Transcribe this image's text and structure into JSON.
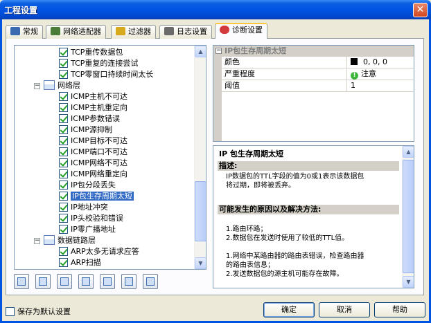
{
  "window": {
    "title": "工程设置",
    "close_glyph": "✕"
  },
  "tabs": [
    {
      "label": "常规",
      "icon": "grid-icon",
      "color": "#3a6ab0"
    },
    {
      "label": "网络适配器",
      "icon": "network-adapter-icon",
      "color": "#4a7c3a"
    },
    {
      "label": "过滤器",
      "icon": "filter-icon",
      "color": "#d7a91c"
    },
    {
      "label": "日志设置",
      "icon": "log-icon",
      "color": "#6b6b6b"
    },
    {
      "label": "诊断设置",
      "icon": "diagnosis-icon",
      "color": "#d33a3a",
      "active": true
    }
  ],
  "tree": {
    "items": [
      {
        "label": "TCP重传数据包",
        "type": "leaf"
      },
      {
        "label": "TCP重复的连接尝试",
        "type": "leaf"
      },
      {
        "label": "TCP零窗口持续时间太长",
        "type": "leaf"
      },
      {
        "label": "网络层",
        "type": "group",
        "expander": "−"
      },
      {
        "label": "ICMP主机不可达",
        "type": "leaf"
      },
      {
        "label": "ICMP主机重定向",
        "type": "leaf"
      },
      {
        "label": "ICMP参数错误",
        "type": "leaf"
      },
      {
        "label": "ICMP源抑制",
        "type": "leaf"
      },
      {
        "label": "ICMP目标不可达",
        "type": "leaf"
      },
      {
        "label": "ICMP端口不可达",
        "type": "leaf"
      },
      {
        "label": "ICMP网络不可达",
        "type": "leaf"
      },
      {
        "label": "ICMP网络重定向",
        "type": "leaf"
      },
      {
        "label": "IP包分段丢失",
        "type": "leaf"
      },
      {
        "label": "IP包生存周期太短",
        "type": "leaf",
        "selected": true
      },
      {
        "label": "IP地址冲突",
        "type": "leaf"
      },
      {
        "label": "IP头校验和错误",
        "type": "leaf"
      },
      {
        "label": "IP零广播地址",
        "type": "leaf"
      },
      {
        "label": "数据链路层",
        "type": "group",
        "expander": "−"
      },
      {
        "label": "ARP太多无请求应答",
        "type": "leaf"
      },
      {
        "label": "ARP扫描",
        "type": "leaf"
      }
    ],
    "scroll": {
      "thumb_fraction_start": 0.62,
      "thumb_fraction_size": 0.3,
      "up": "▲",
      "down": "▼"
    }
  },
  "toolbar": {
    "buttons": [
      "check-all-icon",
      "uncheck-all-icon",
      "invert-check-icon",
      "import-icon",
      "export-icon",
      "expand-icon",
      "collapse-icon"
    ]
  },
  "props": {
    "header": "IP包生存周期太短",
    "collapse_glyph": "−",
    "rows": [
      {
        "key": "颜色",
        "value": "0, 0, 0",
        "swatch": "#000000"
      },
      {
        "key": "严重程度",
        "value": "注意",
        "icon": "!"
      },
      {
        "key": "阈值",
        "value": "1"
      }
    ]
  },
  "desc": {
    "title": "IP 包生存周期太短",
    "section1": "描述:",
    "text1": [
      "IP数据包的TTL字段的值为0或1表示该数据包",
      "将过期，即将被丢弃。"
    ],
    "section2": "可能发生的原因以及解决方法:",
    "text2": [
      "1.路由环路；",
      "2.数据包在发送时使用了较低的TTL值。",
      "",
      "1.网络中某路由器的路由表错误，检查路由器",
      "的路由表信息；",
      "2.发送数据包的源主机可能存在故障。"
    ],
    "scroll": {
      "up": "▲",
      "down": "▼"
    }
  },
  "footer": {
    "save_default": "保存为默认设置",
    "ok": "确定",
    "cancel": "取消",
    "help": "帮助"
  }
}
